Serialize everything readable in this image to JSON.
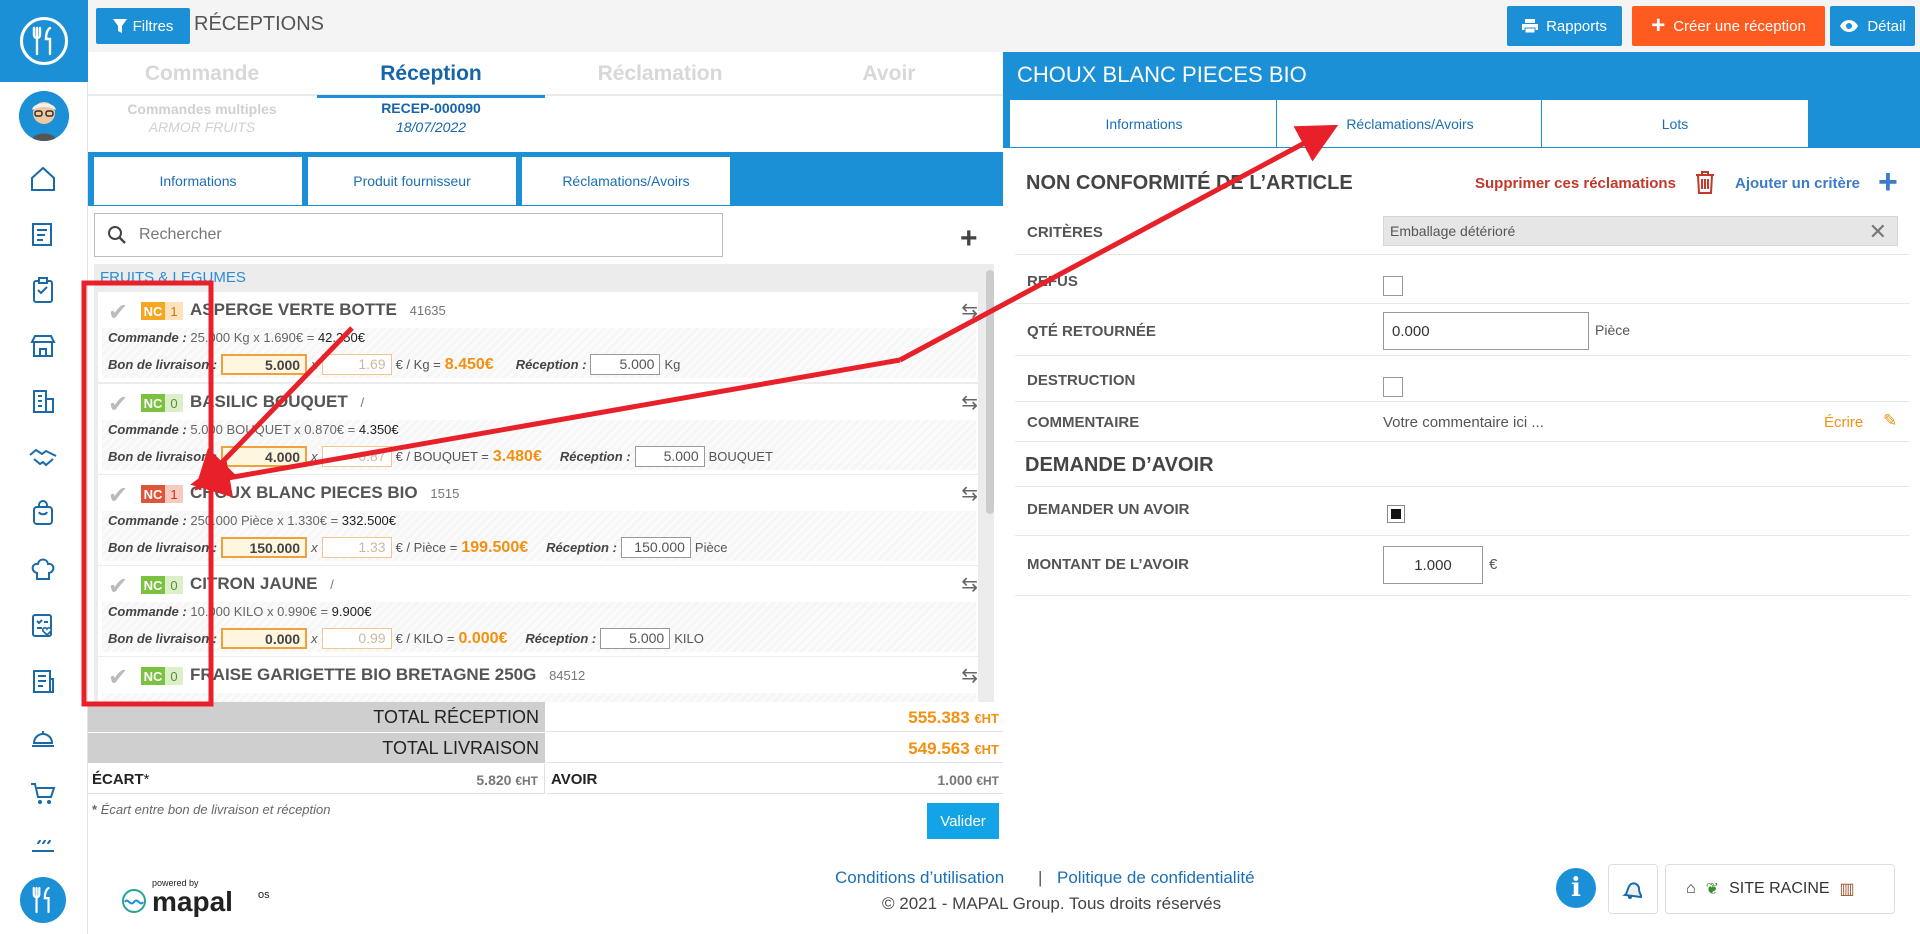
{
  "topbar": {
    "filters_label": "Filtres",
    "page_title": "RÉCEPTIONS",
    "reports_label": "Rapports",
    "create_label": "Créer une réception",
    "detail_label": "Détail"
  },
  "steps": {
    "commande": "Commande",
    "reception": "Réception",
    "reclamation": "Réclamation",
    "avoir": "Avoir",
    "commande_sub1": "Commandes multiples",
    "commande_sub2": "ARMOR FRUITS",
    "reception_sub1": "RECEP-000090",
    "reception_sub2": "18/07/2022"
  },
  "left_tabs": [
    "Informations",
    "Produit fournisseur",
    "Réclamations/Avoirs"
  ],
  "search": {
    "placeholder": "Rechercher"
  },
  "category": "FRUITS & LEGUMES",
  "items": [
    {
      "nc": "NC",
      "count": "1",
      "name": "ASPERGE VERTE BOTTE",
      "code": "41635",
      "cmd_label": "Commande :",
      "cmd_text": "25.000 Kg x  1.690€ =",
      "cmd_total": "42.250€",
      "bl_label": "Bon de livraison :",
      "bl_qty": "5.000",
      "x": "x",
      "bl_price": "1.69",
      "unit_eq": "€ / Kg =",
      "bl_total": "8.450€",
      "rec_label": "Réception :",
      "rec_qty": "5.000",
      "rec_unit": "Kg"
    },
    {
      "nc": "NC",
      "count": "0",
      "name": "BASILIC BOUQUET",
      "code": "/",
      "cmd_label": "Commande :",
      "cmd_text": "5.000 BOUQUET x  0.870€ =",
      "cmd_total": "4.350€",
      "bl_label": "Bon de livraison :",
      "bl_qty": "4.000",
      "x": "x",
      "bl_price": "0.87",
      "unit_eq": "€ / BOUQUET =",
      "bl_total": "3.480€",
      "rec_label": "Réception :",
      "rec_qty": "5.000",
      "rec_unit": "BOUQUET"
    },
    {
      "nc": "NC",
      "count": "1",
      "name": "CHOUX BLANC PIECES BIO",
      "code": "1515",
      "cmd_label": "Commande :",
      "cmd_text": "250.000 Pièce x  1.330€ =",
      "cmd_total": "332.500€",
      "bl_label": "Bon de livraison :",
      "bl_qty": "150.000",
      "x": "x",
      "bl_price": "1.33",
      "unit_eq": "€ / Pièce =",
      "bl_total": "199.500€",
      "rec_label": "Réception :",
      "rec_qty": "150.000",
      "rec_unit": "Pièce"
    },
    {
      "nc": "NC",
      "count": "0",
      "name": "CITRON JAUNE",
      "code": "/",
      "cmd_label": "Commande :",
      "cmd_text": "10.000 KILO x  0.990€ =",
      "cmd_total": "9.900€",
      "bl_label": "Bon de livraison :",
      "bl_qty": "0.000",
      "x": "x",
      "bl_price": "0.99",
      "unit_eq": "€ / KILO =",
      "bl_total": "0.000€",
      "rec_label": "Réception :",
      "rec_qty": "5.000",
      "rec_unit": "KILO"
    },
    {
      "nc": "NC",
      "count": "0",
      "name": "FRAISE GARIGETTE BIO BRETAGNE 250G",
      "code": "84512"
    }
  ],
  "totals": {
    "reception_label": "TOTAL RÉCEPTION",
    "reception_value": "555.383",
    "reception_unit": "€HT",
    "livraison_label": "TOTAL LIVRAISON",
    "livraison_value": "549.563",
    "livraison_unit": "€HT",
    "ecart_label": "ÉCART",
    "ecart_star": "*",
    "ecart_value": "5.820",
    "ecart_unit": "€HT",
    "avoir_label": "AVOIR",
    "avoir_value": "1.000",
    "avoir_unit": "€HT",
    "note_star": "*",
    "note": "Écart entre bon de livraison et réception",
    "validate_label": "Valider"
  },
  "right": {
    "title": "CHOUX BLANC PIECES BIO",
    "tabs": [
      "Informations",
      "Réclamations/Avoirs",
      "Lots"
    ],
    "nc_title": "NON CONFORMITÉ DE L’ARTICLE",
    "delete_label": "Supprimer ces réclamations",
    "add_label": "Ajouter un critère",
    "criteres_label": "CRITÈRES",
    "criteres_value": "Emballage détérioré",
    "refus_label": "REFUS",
    "qte_label": "QTÉ RETOURNÉE",
    "qte_value": "0.000",
    "qte_unit": "Pièce",
    "destruction_label": "DESTRUCTION",
    "comment_label": "COMMENTAIRE",
    "comment_placeholder": "Votre commentaire ici ...",
    "write_label": "Écrire",
    "avoir_title": "DEMANDE D’AVOIR",
    "demande_label": "DEMANDER UN AVOIR",
    "montant_label": "MONTANT DE L’AVOIR",
    "montant_value": "1.000",
    "montant_unit": "€"
  },
  "footer": {
    "powered": "powered by",
    "brand": "mapal",
    "brand_suffix": "os",
    "cgu": "Conditions d’utilisation",
    "sep": "|",
    "privacy": "Politique de confidentialité",
    "copyright": "© 2021 - MAPAL Group. Tous droits réservés",
    "site_label": "SITE RACINE"
  },
  "colors": {
    "primary": "#1b90d6",
    "accent": "#ff5a1f",
    "annotation": "#e8202a",
    "amount": "#f29012"
  }
}
